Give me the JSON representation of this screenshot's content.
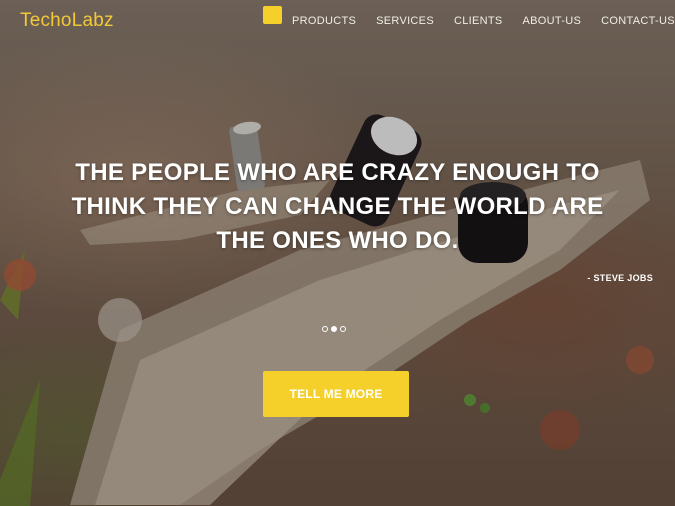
{
  "header": {
    "logo": "TechoLabz",
    "nav": [
      "PRODUCTS",
      "SERVICES",
      "CLIENTS",
      "ABOUT-US",
      "CONTACT-US"
    ]
  },
  "hero": {
    "quote_lines": [
      "THE PEOPLE WHO ARE CRAZY ENOUGH TO",
      "THINK THEY CAN CHANGE THE WORLD ARE",
      "THE ONES WHO DO."
    ],
    "author": "- STEVE JOBS",
    "carousel_active_index": 1,
    "cta_label": "TELL ME MORE"
  },
  "colors": {
    "accent": "#f5d02b",
    "text": "#ffffff"
  }
}
